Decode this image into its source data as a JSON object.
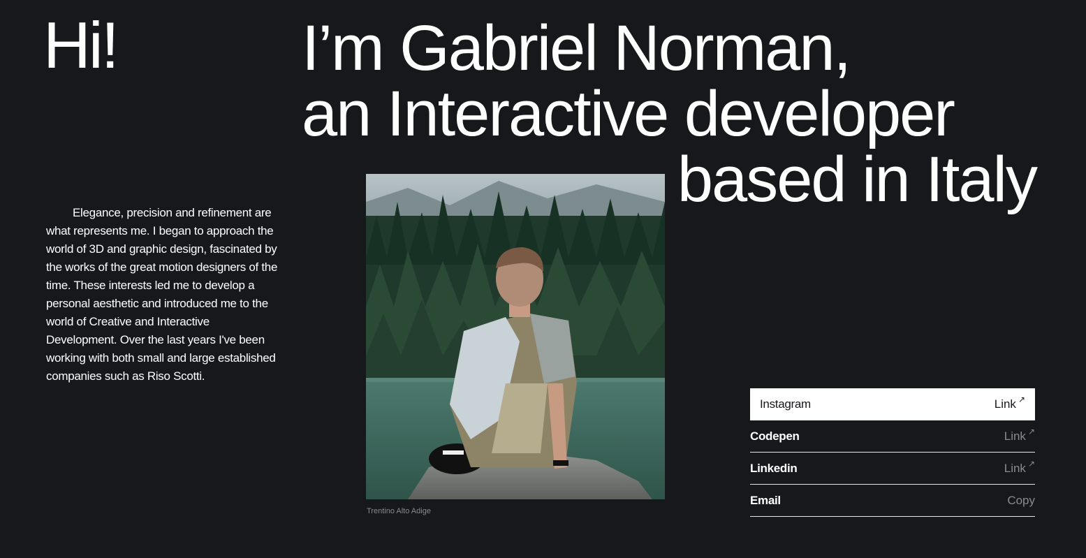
{
  "hero": {
    "greeting": "Hi!",
    "headline_line1": "I’m Gabriel Norman,",
    "headline_line2": "an Interactive developer",
    "headline_line3": "based in Italy"
  },
  "bio": {
    "text": "Elegance, precision and refinement are what represents me. I began to approach the world of 3D and graphic design, fascinated by the works of the great motion designers of the time. These interests led me to develop a personal aesthetic and introduced me to the world of Creative and Interactive Development. Over the last years I've been working with both small and large established companies such as Riso Scotti."
  },
  "photo": {
    "caption": "Trentino Alto Adige"
  },
  "links": [
    {
      "name": "Instagram",
      "action": "Link",
      "icon": "arrow-up-right-icon",
      "active": true
    },
    {
      "name": "Codepen",
      "action": "Link",
      "icon": "arrow-up-right-icon",
      "active": false
    },
    {
      "name": "Linkedin",
      "action": "Link",
      "icon": "arrow-up-right-icon",
      "active": false
    },
    {
      "name": "Email",
      "action": "Copy",
      "icon": "",
      "active": false
    }
  ],
  "colors": {
    "background": "#17181c",
    "text": "#ffffff",
    "muted": "#8a8b90",
    "active_row_bg": "#ffffff"
  }
}
